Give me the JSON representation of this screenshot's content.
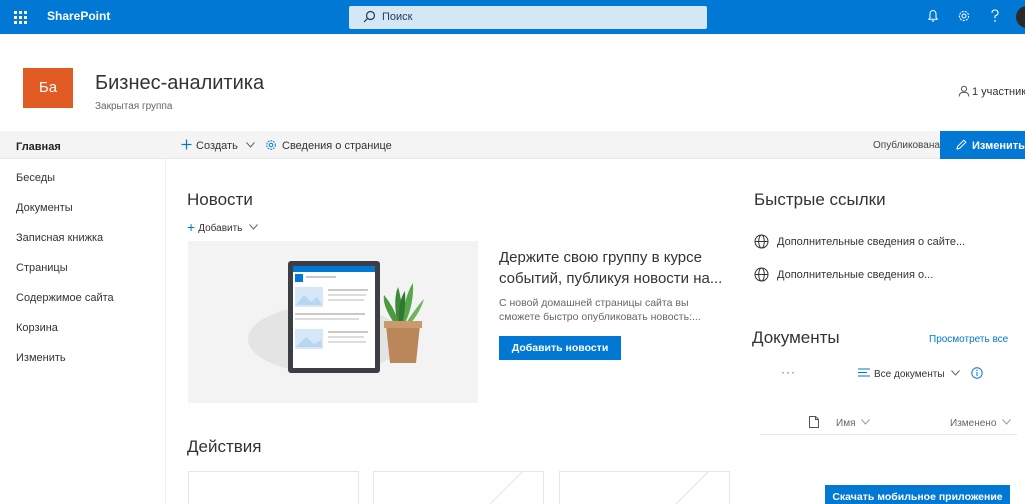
{
  "suite": {
    "app_name": "SharePoint",
    "search_placeholder": "Поиск"
  },
  "site": {
    "logo_text": "Ба",
    "title": "Бизнес-аналитика",
    "subtitle": "Закрытая группа",
    "members": "1 участник"
  },
  "nav": {
    "items": [
      {
        "label": "Главная"
      },
      {
        "label": "Беседы"
      },
      {
        "label": "Документы"
      },
      {
        "label": "Записная книжка"
      },
      {
        "label": "Страницы"
      },
      {
        "label": "Содержимое сайта"
      },
      {
        "label": "Корзина"
      },
      {
        "label": "Изменить"
      }
    ]
  },
  "command": {
    "create": "Создать",
    "page_details": "Сведения о странице",
    "status": "Опубликована",
    "edit": "Изменить"
  },
  "news": {
    "heading": "Новости",
    "add": "Добавить",
    "headline": "Держите свою группу в курсе событий, публикуя новости на...",
    "body": "С новой домашней страницы сайта вы сможете быстро опубликовать новость:...",
    "button": "Добавить новости"
  },
  "actions": {
    "heading": "Действия"
  },
  "quicklinks": {
    "heading": "Быстрые ссылки",
    "items": [
      {
        "label": "Дополнительные сведения о сайте..."
      },
      {
        "label": "Дополнительные сведения о..."
      }
    ]
  },
  "documents": {
    "heading": "Документы",
    "view_all": "Просмотреть все",
    "more": "···",
    "view_name": "Все документы",
    "col_name": "Имя",
    "col_modified": "Изменено",
    "mobile_button": "Скачать мобильное приложение"
  },
  "colors": {
    "brand_blue": "#0078d4",
    "site_logo": "#e25a24"
  }
}
